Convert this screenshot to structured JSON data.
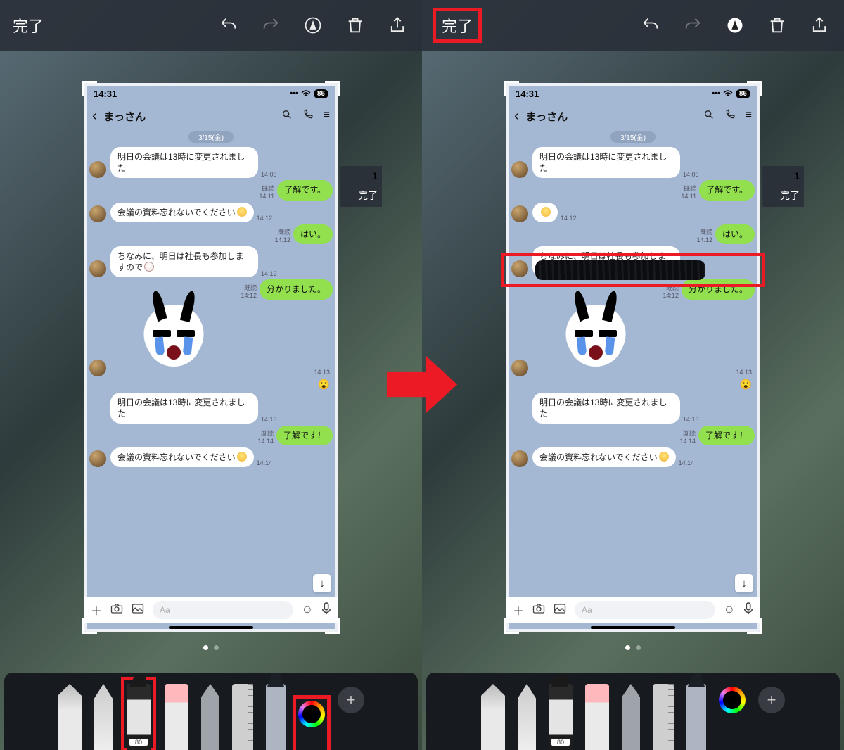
{
  "toolbar": {
    "done": "完了"
  },
  "phone": {
    "time": "14:31",
    "battery": "86",
    "contact_name": "まっさん",
    "date_badge": "3/15(金)",
    "input_placeholder": "Aa",
    "bg_peek_done": "完了",
    "bg_peek_time": "1"
  },
  "messages": [
    {
      "side": "recv",
      "text": "明日の会議は13時に変更されました",
      "time": "14:08"
    },
    {
      "side": "sent",
      "text": "了解です。",
      "time": "14:11",
      "read": "既読"
    },
    {
      "side": "recv",
      "text": "会議の資料忘れないでください",
      "time": "14:12",
      "emoji": true
    },
    {
      "side": "sent",
      "text": "はい。",
      "time": "14:12",
      "read": "既読"
    },
    {
      "side": "recv",
      "text": "ちなみに、明日は社長も参加しますので",
      "time": "14:12",
      "emoji2": true
    },
    {
      "side": "sent",
      "text": "分かりました。",
      "time": "14:12",
      "read": "既読"
    },
    {
      "side": "sticker",
      "time": "14:13"
    },
    {
      "side": "recv",
      "text": "明日の会議は13時に変更されました",
      "time": "14:13",
      "noavatar": true
    },
    {
      "side": "sent",
      "text": "了解です！",
      "time": "14:14",
      "read": "既読"
    },
    {
      "side": "recv",
      "text": "会議の資料忘れないでください",
      "time": "14:14",
      "emoji": true
    }
  ],
  "sticker_read": "😮"
}
